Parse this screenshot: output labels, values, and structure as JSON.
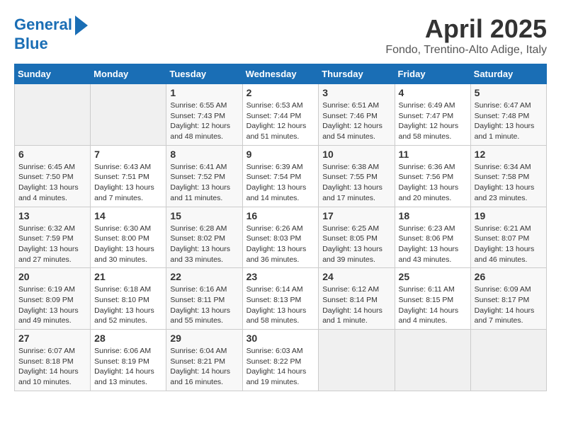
{
  "logo": {
    "line1": "General",
    "line2": "Blue"
  },
  "title": "April 2025",
  "location": "Fondo, Trentino-Alto Adige, Italy",
  "weekdays": [
    "Sunday",
    "Monday",
    "Tuesday",
    "Wednesday",
    "Thursday",
    "Friday",
    "Saturday"
  ],
  "weeks": [
    [
      {
        "day": "",
        "info": ""
      },
      {
        "day": "",
        "info": ""
      },
      {
        "day": "1",
        "info": "Sunrise: 6:55 AM\nSunset: 7:43 PM\nDaylight: 12 hours\nand 48 minutes."
      },
      {
        "day": "2",
        "info": "Sunrise: 6:53 AM\nSunset: 7:44 PM\nDaylight: 12 hours\nand 51 minutes."
      },
      {
        "day": "3",
        "info": "Sunrise: 6:51 AM\nSunset: 7:46 PM\nDaylight: 12 hours\nand 54 minutes."
      },
      {
        "day": "4",
        "info": "Sunrise: 6:49 AM\nSunset: 7:47 PM\nDaylight: 12 hours\nand 58 minutes."
      },
      {
        "day": "5",
        "info": "Sunrise: 6:47 AM\nSunset: 7:48 PM\nDaylight: 13 hours\nand 1 minute."
      }
    ],
    [
      {
        "day": "6",
        "info": "Sunrise: 6:45 AM\nSunset: 7:50 PM\nDaylight: 13 hours\nand 4 minutes."
      },
      {
        "day": "7",
        "info": "Sunrise: 6:43 AM\nSunset: 7:51 PM\nDaylight: 13 hours\nand 7 minutes."
      },
      {
        "day": "8",
        "info": "Sunrise: 6:41 AM\nSunset: 7:52 PM\nDaylight: 13 hours\nand 11 minutes."
      },
      {
        "day": "9",
        "info": "Sunrise: 6:39 AM\nSunset: 7:54 PM\nDaylight: 13 hours\nand 14 minutes."
      },
      {
        "day": "10",
        "info": "Sunrise: 6:38 AM\nSunset: 7:55 PM\nDaylight: 13 hours\nand 17 minutes."
      },
      {
        "day": "11",
        "info": "Sunrise: 6:36 AM\nSunset: 7:56 PM\nDaylight: 13 hours\nand 20 minutes."
      },
      {
        "day": "12",
        "info": "Sunrise: 6:34 AM\nSunset: 7:58 PM\nDaylight: 13 hours\nand 23 minutes."
      }
    ],
    [
      {
        "day": "13",
        "info": "Sunrise: 6:32 AM\nSunset: 7:59 PM\nDaylight: 13 hours\nand 27 minutes."
      },
      {
        "day": "14",
        "info": "Sunrise: 6:30 AM\nSunset: 8:00 PM\nDaylight: 13 hours\nand 30 minutes."
      },
      {
        "day": "15",
        "info": "Sunrise: 6:28 AM\nSunset: 8:02 PM\nDaylight: 13 hours\nand 33 minutes."
      },
      {
        "day": "16",
        "info": "Sunrise: 6:26 AM\nSunset: 8:03 PM\nDaylight: 13 hours\nand 36 minutes."
      },
      {
        "day": "17",
        "info": "Sunrise: 6:25 AM\nSunset: 8:05 PM\nDaylight: 13 hours\nand 39 minutes."
      },
      {
        "day": "18",
        "info": "Sunrise: 6:23 AM\nSunset: 8:06 PM\nDaylight: 13 hours\nand 43 minutes."
      },
      {
        "day": "19",
        "info": "Sunrise: 6:21 AM\nSunset: 8:07 PM\nDaylight: 13 hours\nand 46 minutes."
      }
    ],
    [
      {
        "day": "20",
        "info": "Sunrise: 6:19 AM\nSunset: 8:09 PM\nDaylight: 13 hours\nand 49 minutes."
      },
      {
        "day": "21",
        "info": "Sunrise: 6:18 AM\nSunset: 8:10 PM\nDaylight: 13 hours\nand 52 minutes."
      },
      {
        "day": "22",
        "info": "Sunrise: 6:16 AM\nSunset: 8:11 PM\nDaylight: 13 hours\nand 55 minutes."
      },
      {
        "day": "23",
        "info": "Sunrise: 6:14 AM\nSunset: 8:13 PM\nDaylight: 13 hours\nand 58 minutes."
      },
      {
        "day": "24",
        "info": "Sunrise: 6:12 AM\nSunset: 8:14 PM\nDaylight: 14 hours\nand 1 minute."
      },
      {
        "day": "25",
        "info": "Sunrise: 6:11 AM\nSunset: 8:15 PM\nDaylight: 14 hours\nand 4 minutes."
      },
      {
        "day": "26",
        "info": "Sunrise: 6:09 AM\nSunset: 8:17 PM\nDaylight: 14 hours\nand 7 minutes."
      }
    ],
    [
      {
        "day": "27",
        "info": "Sunrise: 6:07 AM\nSunset: 8:18 PM\nDaylight: 14 hours\nand 10 minutes."
      },
      {
        "day": "28",
        "info": "Sunrise: 6:06 AM\nSunset: 8:19 PM\nDaylight: 14 hours\nand 13 minutes."
      },
      {
        "day": "29",
        "info": "Sunrise: 6:04 AM\nSunset: 8:21 PM\nDaylight: 14 hours\nand 16 minutes."
      },
      {
        "day": "30",
        "info": "Sunrise: 6:03 AM\nSunset: 8:22 PM\nDaylight: 14 hours\nand 19 minutes."
      },
      {
        "day": "",
        "info": ""
      },
      {
        "day": "",
        "info": ""
      },
      {
        "day": "",
        "info": ""
      }
    ]
  ]
}
